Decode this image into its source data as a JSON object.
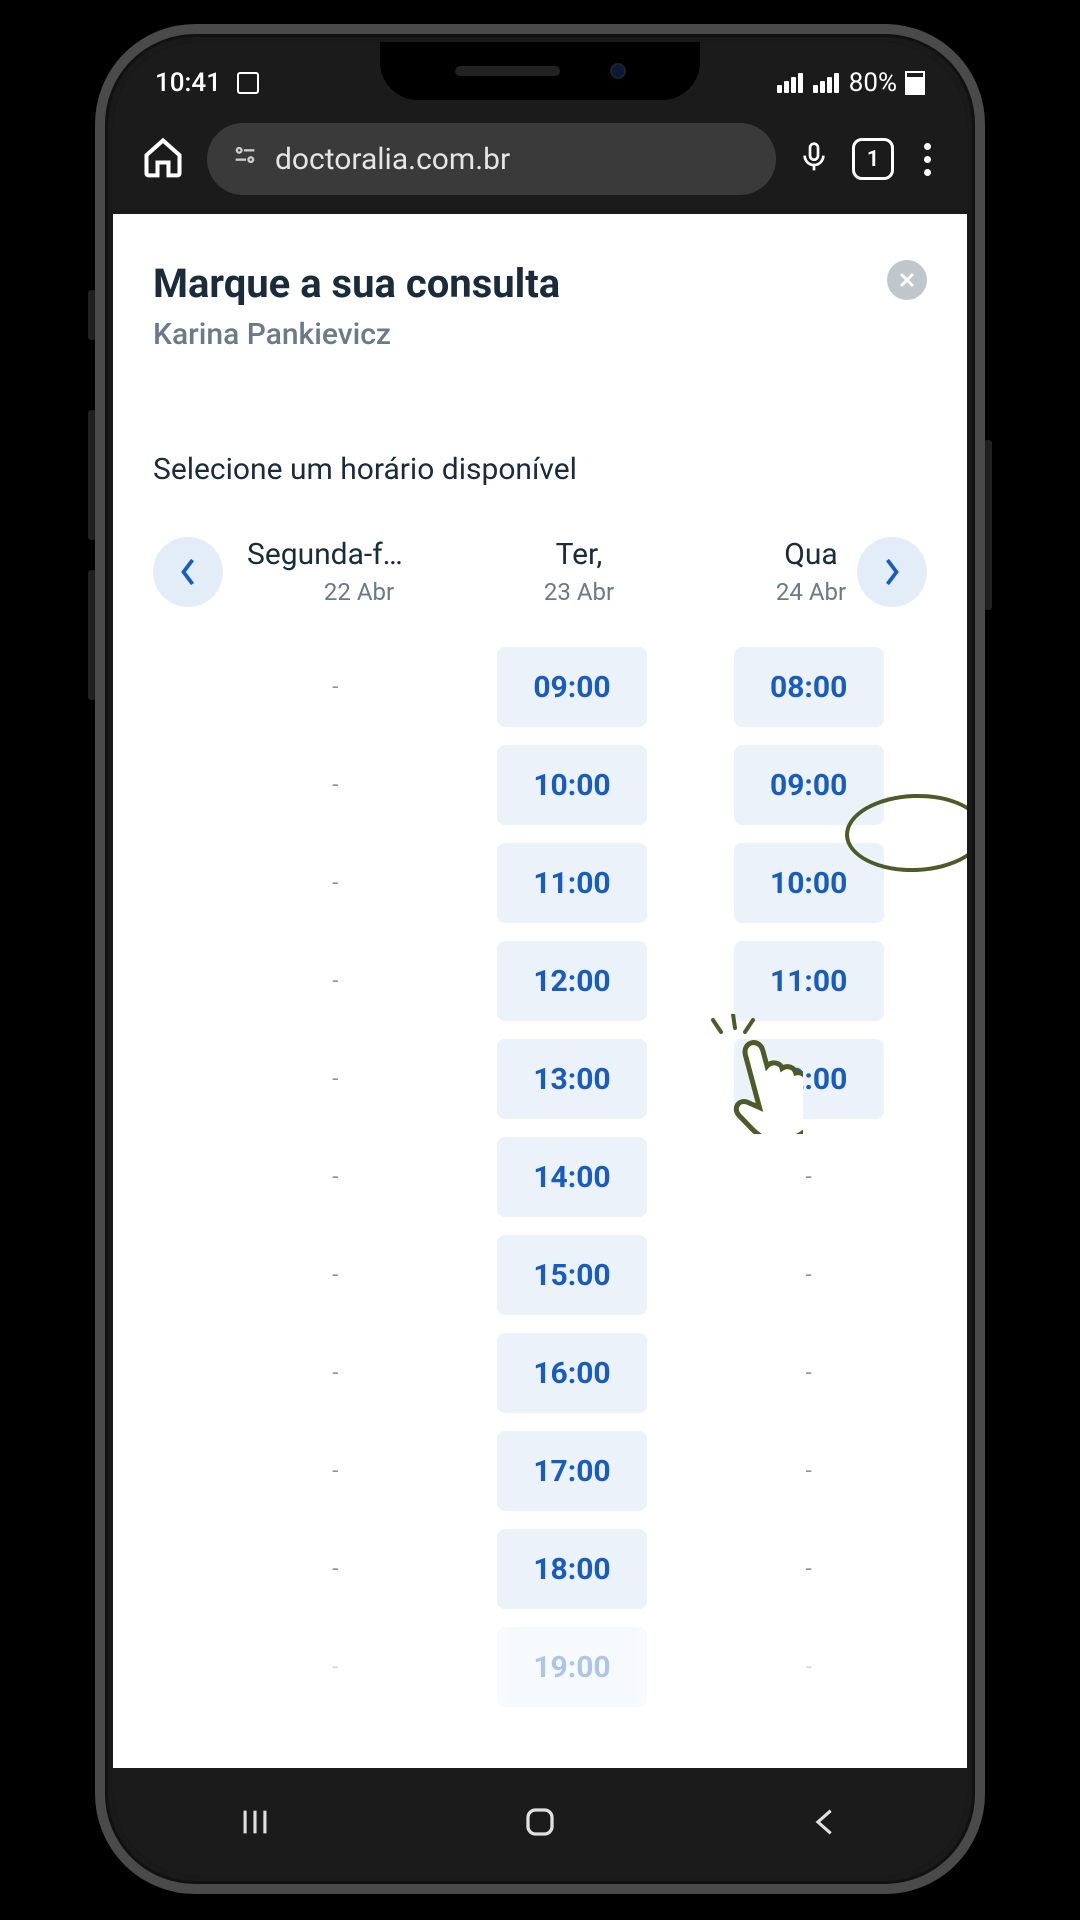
{
  "status_bar": {
    "time": "10:41",
    "battery": "80%"
  },
  "browser": {
    "url": "doctoralia.com.br",
    "tab_count": "1"
  },
  "page": {
    "title": "Marque a sua consulta",
    "subtitle": "Karina Pankievicz",
    "section_label": "Selecione um horário disponível"
  },
  "days": [
    {
      "name": "Segunda-f…",
      "date": "22 Abr"
    },
    {
      "name": "Ter,",
      "date": "23 Abr"
    },
    {
      "name": "Qua",
      "date": "24 Abr"
    }
  ],
  "slots": [
    {
      "c0": "-",
      "c1": "09:00",
      "c2": "08:00"
    },
    {
      "c0": "-",
      "c1": "10:00",
      "c2": "09:00"
    },
    {
      "c0": "-",
      "c1": "11:00",
      "c2": "10:00"
    },
    {
      "c0": "-",
      "c1": "12:00",
      "c2": "11:00"
    },
    {
      "c0": "-",
      "c1": "13:00",
      "c2": "12:00"
    },
    {
      "c0": "-",
      "c1": "14:00",
      "c2": "-"
    },
    {
      "c0": "-",
      "c1": "15:00",
      "c2": "-"
    },
    {
      "c0": "-",
      "c1": "16:00",
      "c2": "-"
    },
    {
      "c0": "-",
      "c1": "17:00",
      "c2": "-"
    },
    {
      "c0": "-",
      "c1": "18:00",
      "c2": "-"
    }
  ],
  "peek_slot": "19:00",
  "dash": "-"
}
